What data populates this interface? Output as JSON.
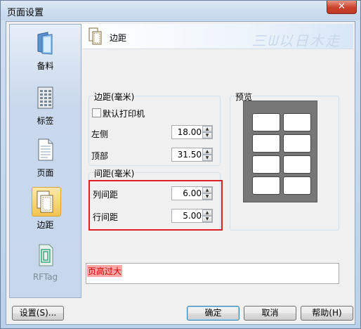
{
  "window": {
    "title": "页面设置",
    "close_glyph": "✕"
  },
  "sidebar": {
    "items": [
      {
        "label": "备料",
        "icon": "folder-icon"
      },
      {
        "label": "标签",
        "icon": "grid-sheet-icon"
      },
      {
        "label": "页面",
        "icon": "page-icon"
      },
      {
        "label": "边距",
        "icon": "margin-pages-icon",
        "active": true
      },
      {
        "label": "RFTag",
        "icon": "rftag-icon",
        "disabled": true
      }
    ]
  },
  "header": {
    "title": "边距",
    "watermark": "三ᗯ以日木走"
  },
  "margins": {
    "group_title": "边距(毫米)",
    "default_printer_label": "默认打印机",
    "default_printer_checked": false,
    "left_label": "左侧",
    "left_value": "18.00",
    "top_label": "顶部",
    "top_value": "31.50"
  },
  "spacing": {
    "group_title": "间距(毫米)",
    "column_label": "列间距",
    "column_value": "6.00",
    "row_label": "行间距",
    "row_value": "5.00"
  },
  "preview": {
    "title": "预览",
    "columns": 2,
    "rows": 4
  },
  "status": {
    "message": "页高过大"
  },
  "buttons": {
    "setup": "设置(S)...",
    "ok": "确定",
    "cancel": "取消",
    "help": "帮助(H)"
  },
  "colors": {
    "error_text": "#d60000",
    "error_highlight": "#ffa6a6",
    "annotation_box": "#e02020",
    "active_item": "#f6c34e"
  }
}
